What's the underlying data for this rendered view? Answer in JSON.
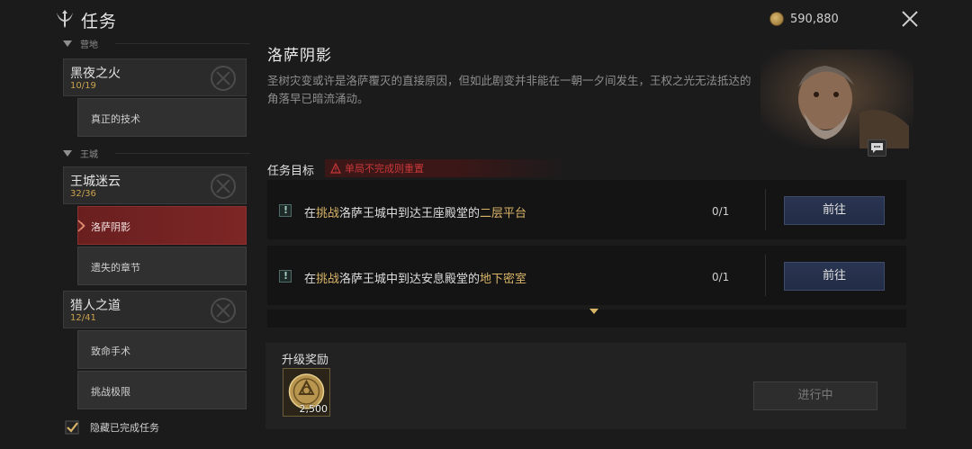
{
  "header": {
    "title": "任务",
    "currency_amount": "590,880",
    "close_icon": "close-icon"
  },
  "sidebar": {
    "sections": [
      {
        "name": "营地"
      },
      {
        "name": "王城"
      }
    ],
    "chapters": [
      {
        "name": "黑夜之火",
        "progress": "10/19"
      },
      {
        "name": "王城迷云",
        "progress": "32/36"
      },
      {
        "name": "猎人之道",
        "progress": "12/41"
      }
    ],
    "quests": [
      {
        "label": "真正的技术",
        "active": false
      },
      {
        "label": "洛萨阴影",
        "active": true
      },
      {
        "label": "遗失的章节",
        "active": false
      },
      {
        "label": "致命手术",
        "active": false
      },
      {
        "label": "挑战极限",
        "active": false
      }
    ],
    "hide_completed": {
      "label": "隐藏已完成任务",
      "checked": true
    }
  },
  "quest": {
    "title": "洛萨阴影",
    "description": "圣树灾变或许是洛萨覆灭的直接原因，但如此剧变并非能在一朝一夕间发生，王权之光无法抵达的角落早已暗流涌动。",
    "objectives_label": "任务目标",
    "warning": "单局不完成则重置",
    "objectives": [
      {
        "prefix": "在",
        "hl1": "挑战",
        "mid": "洛萨王城中到达王座殿堂的",
        "hl2": "二层平台",
        "count": "0/1",
        "button": "前往"
      },
      {
        "prefix": "在",
        "hl1": "挑战",
        "mid": "洛萨王城中到达安息殿堂的",
        "hl2": "地下密室",
        "count": "0/1",
        "button": "前往"
      }
    ],
    "reward_label": "升级奖励",
    "reward_count": "2,500",
    "status_button": "进行中"
  },
  "colors": {
    "accent_gold": "#c9a24b",
    "active_red": "#7d2626",
    "warning_red": "#c8383a",
    "button_blue": "#2a3552"
  }
}
